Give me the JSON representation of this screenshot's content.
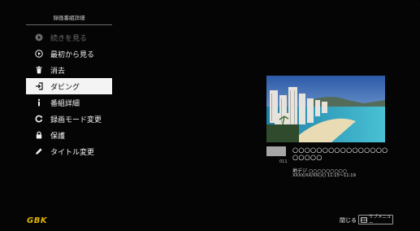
{
  "menu": {
    "title": "録画番組詳細",
    "items": [
      {
        "label": "続きを見る",
        "icon": "resume-icon",
        "state": "disabled"
      },
      {
        "label": "最初から見る",
        "icon": "play-circle-icon",
        "state": "normal"
      },
      {
        "label": "消去",
        "icon": "trash-icon",
        "state": "normal"
      },
      {
        "label": "ダビング",
        "icon": "dubbing-icon",
        "state": "selected"
      },
      {
        "label": "番組詳細",
        "icon": "info-icon",
        "state": "normal"
      },
      {
        "label": "録画モード変更",
        "icon": "refresh-icon",
        "state": "normal"
      },
      {
        "label": "保護",
        "icon": "lock-icon",
        "state": "normal"
      },
      {
        "label": "タイトル変更",
        "icon": "pencil-icon",
        "state": "normal"
      }
    ]
  },
  "program": {
    "channel_number": "011",
    "title": "○○○○○○○○○○○○○○○○○○○○○",
    "line1": "地デジ ○○○○○○○○○",
    "line2": "XXXX/XX/XX(火) 11:15～11:19",
    "thumbnail": "beach-city-thumbnail"
  },
  "footer": {
    "logo_text": "GBK",
    "close_label": "閉じる",
    "submenu_label": "サブメニュー",
    "submenu_key": "SUB"
  },
  "colors": {
    "background": "#050505",
    "selected_bg": "#f4f4f4",
    "disabled_text": "#6a6a6a",
    "logo": "#e0b400"
  }
}
